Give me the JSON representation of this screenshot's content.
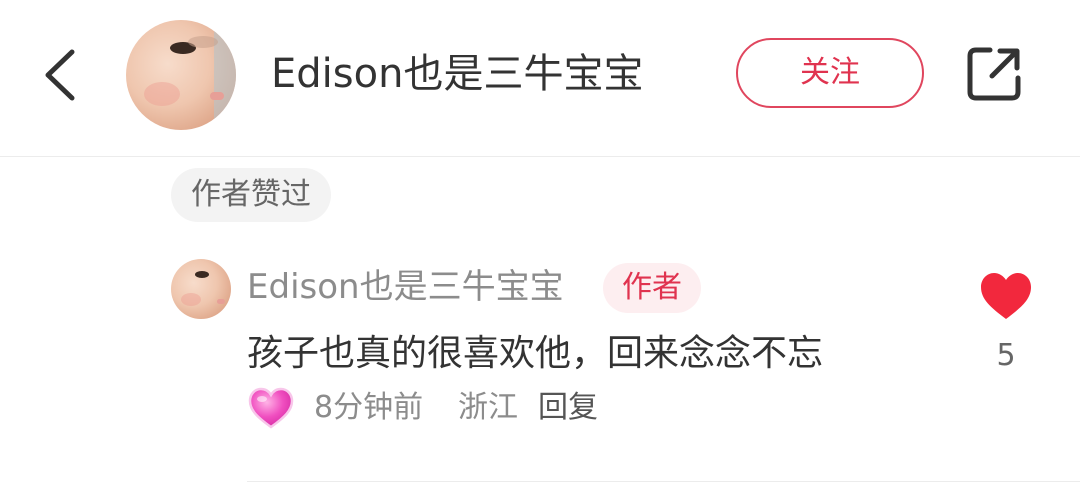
{
  "header": {
    "back_icon": "chevron-left-icon",
    "user_name": "Edison也是三牛宝宝",
    "follow_label": "关注",
    "share_icon": "share-external-icon"
  },
  "liked_tag": {
    "label": "作者赞过"
  },
  "comment": {
    "user_name": "Edison也是三牛宝宝",
    "author_badge": "作者",
    "text": "孩子也真的很喜欢他，回来念念不忘",
    "reaction_icon": "pink-heart-emoji-icon",
    "time": "8分钟前",
    "location": "浙江",
    "reply_label": "回复",
    "like_icon": "heart-icon",
    "like_count": "5"
  },
  "colors": {
    "accent": "#e0334f",
    "like_heart": "#f2283d",
    "text_primary": "#333333",
    "text_secondary": "#8c8c8c",
    "tag_bg": "#f3f3f3",
    "badge_bg": "#fdeef0"
  }
}
